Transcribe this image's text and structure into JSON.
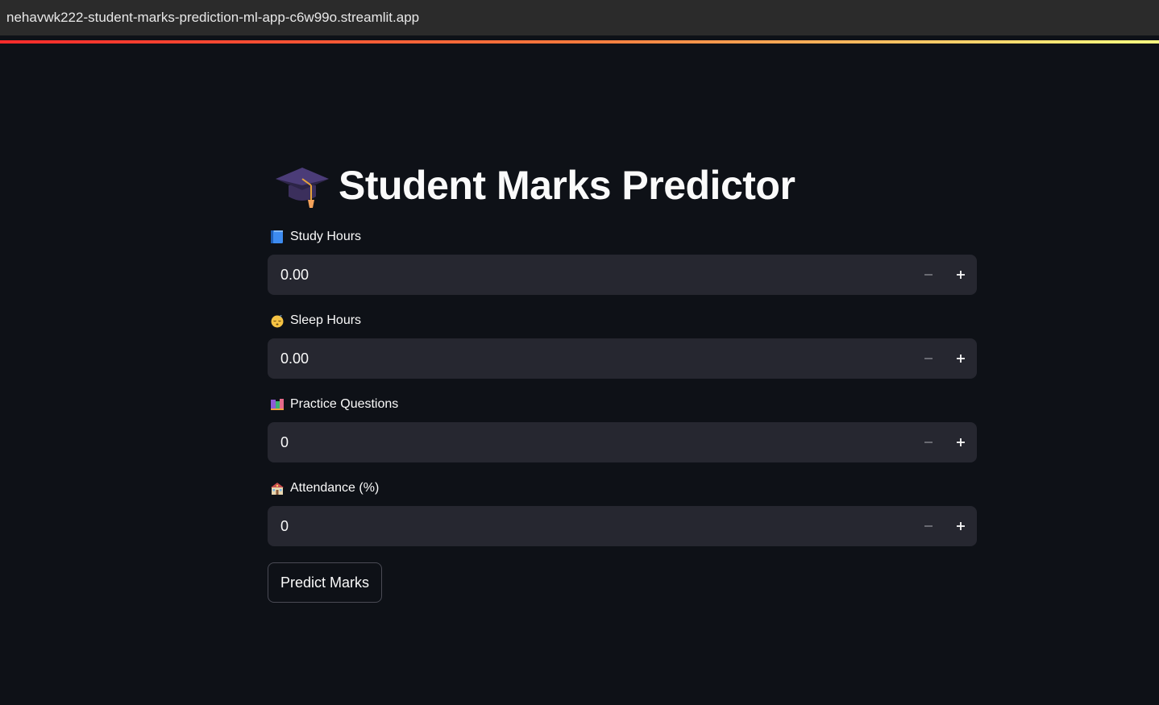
{
  "browser": {
    "url": "nehavwk222-student-marks-prediction-ml-app-c6w99o.streamlit.app"
  },
  "app": {
    "title": "Student Marks Predictor",
    "title_icon": "graduation-cap-icon",
    "fields": [
      {
        "label": "Study Hours",
        "icon": "blue-book-icon",
        "value": "0.00"
      },
      {
        "label": "Sleep Hours",
        "icon": "sleeping-face-icon",
        "value": "0.00"
      },
      {
        "label": "Practice Questions",
        "icon": "books-icon",
        "value": "0"
      },
      {
        "label": "Attendance (%)",
        "icon": "school-icon",
        "value": "0"
      }
    ],
    "predict_label": "Predict Marks"
  },
  "colors": {
    "background": "#0e1117",
    "input_bg": "#262730",
    "text": "#fafafa",
    "accent_gradient": [
      "#ff2b2b",
      "#fffd80"
    ]
  }
}
